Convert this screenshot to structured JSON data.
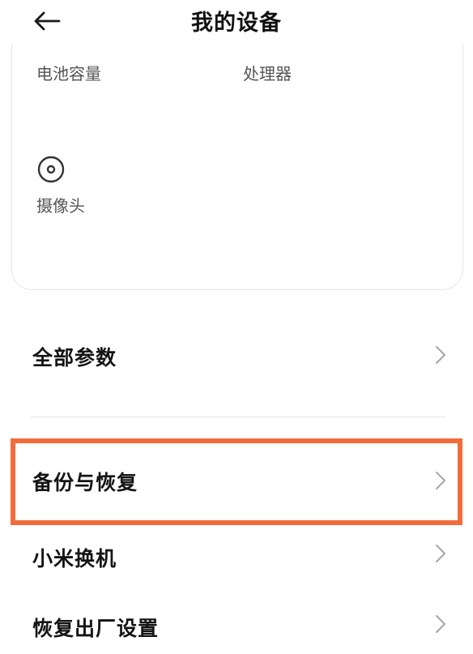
{
  "header": {
    "title": "我的设备",
    "back_icon": "arrow-left-icon"
  },
  "spec_card": {
    "battery_label": "电池容量",
    "processor_label": "处理器",
    "camera_label": "摄像头",
    "camera_icon": "camera-lens-icon"
  },
  "menu": {
    "all_params": "全部参数",
    "backup_restore": "备份与恢复",
    "mi_mover": "小米换机",
    "factory_reset": "恢复出厂设置",
    "chevron_icon": "chevron-right-icon"
  },
  "colors": {
    "highlight_border": "#f26c3b",
    "text_primary": "#141414",
    "text_secondary": "#555555",
    "chevron": "#a6a6a6"
  }
}
